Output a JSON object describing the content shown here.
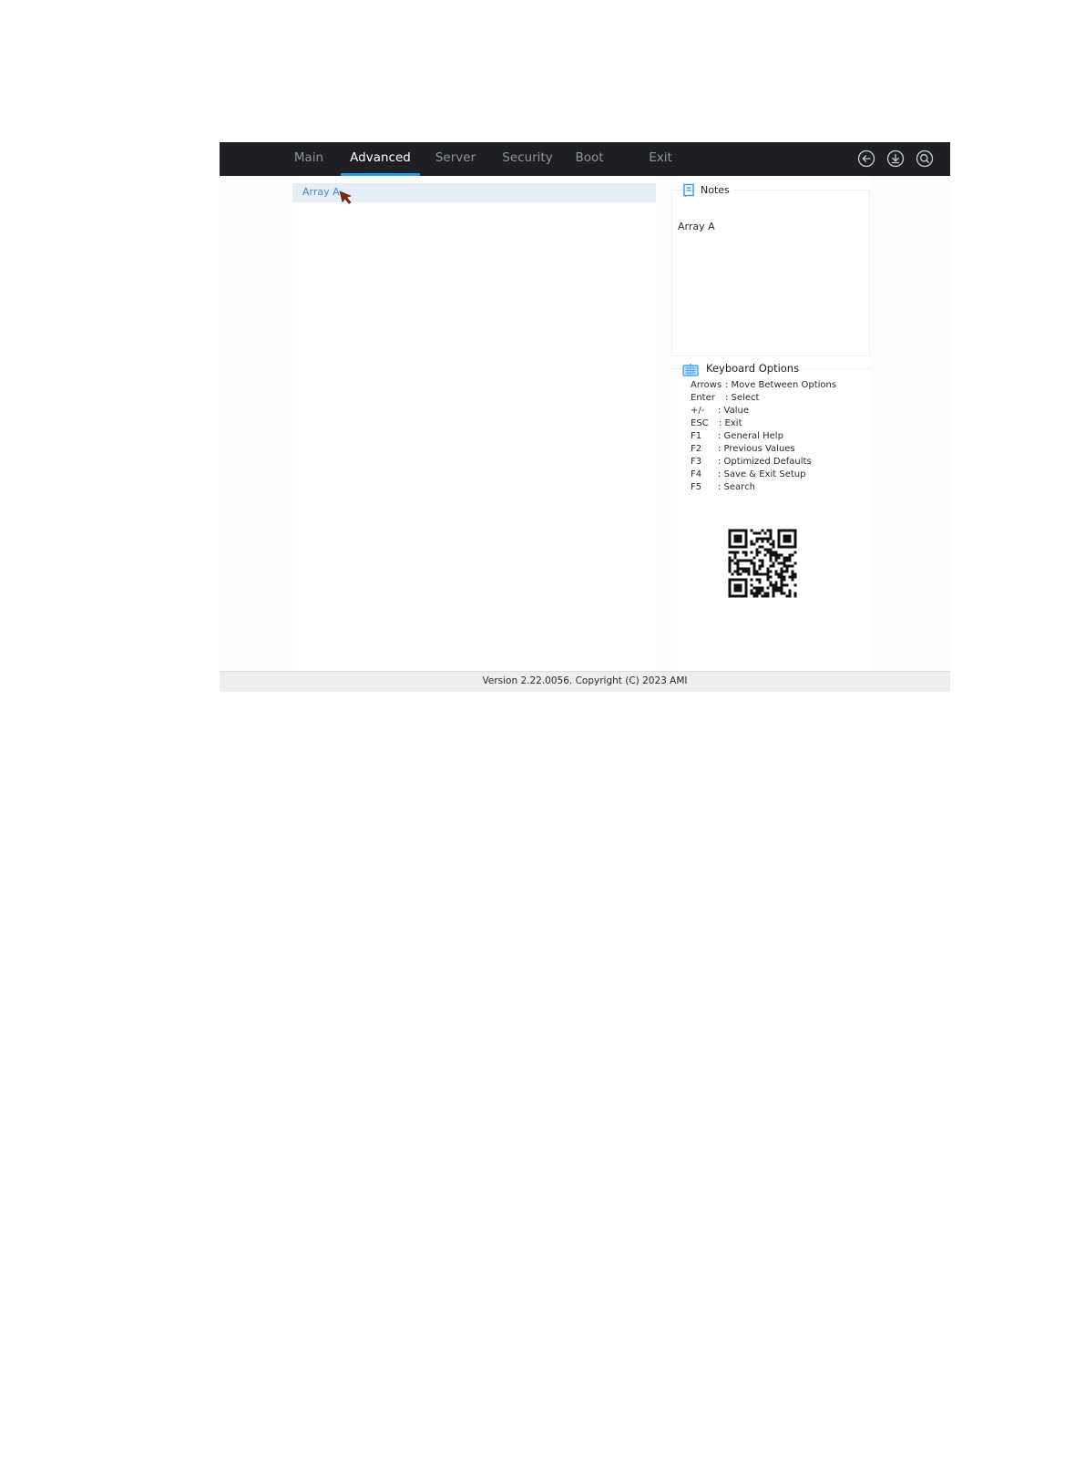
{
  "topbar": {
    "tabs": [
      {
        "label": "Main"
      },
      {
        "label": "Advanced",
        "active": true
      },
      {
        "label": "Server"
      },
      {
        "label": "Security"
      },
      {
        "label": "Boot"
      },
      {
        "label": "Exit"
      }
    ],
    "icons": [
      "back-icon",
      "download-icon",
      "search-icon"
    ]
  },
  "menu": {
    "items": [
      {
        "label": "Array A",
        "selected": true
      }
    ]
  },
  "notes": {
    "title": "Notes",
    "text": "Array A"
  },
  "keyboard": {
    "title": "Keyboard Options",
    "rows": [
      {
        "key": "Arrows",
        "desc": ": Move Between Options"
      },
      {
        "key": "Enter",
        "desc": ": Select"
      },
      {
        "key": "+/-",
        "desc": ": Value"
      },
      {
        "key": "ESC",
        "desc": ": Exit"
      },
      {
        "key": "F1",
        "desc": ": General Help"
      },
      {
        "key": "F2",
        "desc": ": Previous Values"
      },
      {
        "key": "F3",
        "desc": ": Optimized Defaults"
      },
      {
        "key": "F4",
        "desc": ": Save & Exit Setup"
      },
      {
        "key": "F5",
        "desc": ": Search"
      }
    ]
  },
  "footer": {
    "text": "Version 2.22.0056. Copyright (C) 2023 AMI"
  },
  "colors": {
    "topbar_bg": "#1d1f23",
    "accent": "#2e9bea",
    "selected_bg": "#e4eef8",
    "selected_text": "#4c86d1"
  }
}
